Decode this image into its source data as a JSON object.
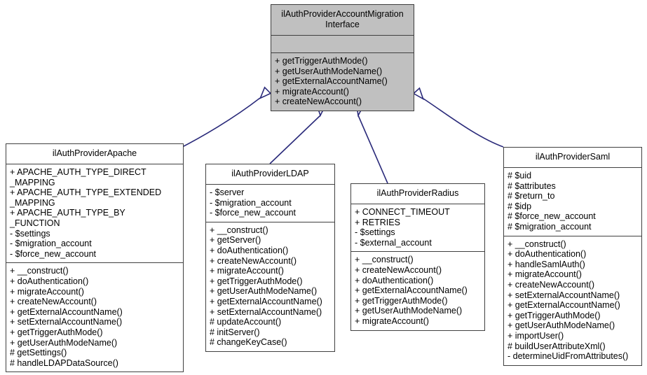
{
  "diagram": {
    "kind": "uml-class-diagram",
    "title": "ilAuthProviderAccountMigrationInterface inheritance diagram",
    "colors": {
      "interface_fill": "#c0c0c0",
      "class_fill": "#ffffff",
      "border": "#404040",
      "edge": "#2a2a7a",
      "text": "#000000"
    }
  },
  "classes": [
    {
      "id": "interface",
      "name": "ilAuthProviderAccountMigration\nInterface",
      "is_interface": true,
      "attributes": [],
      "methods": [
        "+ getTriggerAuthMode()",
        "+ getUserAuthModeName()",
        "+ getExternalAccountName()",
        "+ migrateAccount()",
        "+ createNewAccount()"
      ]
    },
    {
      "id": "apache",
      "name": "ilAuthProviderApache",
      "is_interface": false,
      "attributes": [
        "+ APACHE_AUTH_TYPE_DIRECT\n_MAPPING",
        "+ APACHE_AUTH_TYPE_EXTENDED\n_MAPPING",
        "+ APACHE_AUTH_TYPE_BY\n_FUNCTION",
        "- $settings",
        "- $migration_account",
        "- $force_new_account"
      ],
      "methods": [
        "+ __construct()",
        "+ doAuthentication()",
        "+ migrateAccount()",
        "+ createNewAccount()",
        "+ getExternalAccountName()",
        "+ setExternalAccountName()",
        "+ getTriggerAuthMode()",
        "+ getUserAuthModeName()",
        "# getSettings()",
        "# handleLDAPDataSource()"
      ]
    },
    {
      "id": "ldap",
      "name": "ilAuthProviderLDAP",
      "is_interface": false,
      "attributes": [
        "- $server",
        "- $migration_account",
        "- $force_new_account"
      ],
      "methods": [
        "+ __construct()",
        "+ getServer()",
        "+ doAuthentication()",
        "+ createNewAccount()",
        "+ migrateAccount()",
        "+ getTriggerAuthMode()",
        "+ getUserAuthModeName()",
        "+ getExternalAccountName()",
        "+ setExternalAccountName()",
        "# updateAccount()",
        "# initServer()",
        "# changeKeyCase()"
      ]
    },
    {
      "id": "radius",
      "name": "ilAuthProviderRadius",
      "is_interface": false,
      "attributes": [
        "+ CONNECT_TIMEOUT",
        "+ RETRIES",
        "- $settings",
        "- $external_account"
      ],
      "methods": [
        "+ __construct()",
        "+ createNewAccount()",
        "+ doAuthentication()",
        "+ getExternalAccountName()",
        "+ getTriggerAuthMode()",
        "+ getUserAuthModeName()",
        "+ migrateAccount()"
      ]
    },
    {
      "id": "saml",
      "name": "ilAuthProviderSaml",
      "is_interface": false,
      "attributes": [
        "# $uid",
        "# $attributes",
        "# $return_to",
        "# $idp",
        "# $force_new_account",
        "# $migration_account"
      ],
      "methods": [
        "+ __construct()",
        "+ doAuthentication()",
        "+ handleSamlAuth()",
        "+ migrateAccount()",
        "+ createNewAccount()",
        "+ setExternalAccountName()",
        "+ getExternalAccountName()",
        "+ getTriggerAuthMode()",
        "+ getUserAuthModeName()",
        "+ importUser()",
        "# buildUserAttributeXml()",
        "- determineUidFromAttributes()"
      ]
    }
  ],
  "edges": [
    {
      "from": "apache",
      "to": "interface",
      "type": "realization"
    },
    {
      "from": "ldap",
      "to": "interface",
      "type": "realization"
    },
    {
      "from": "radius",
      "to": "interface",
      "type": "realization"
    },
    {
      "from": "saml",
      "to": "interface",
      "type": "realization"
    }
  ]
}
